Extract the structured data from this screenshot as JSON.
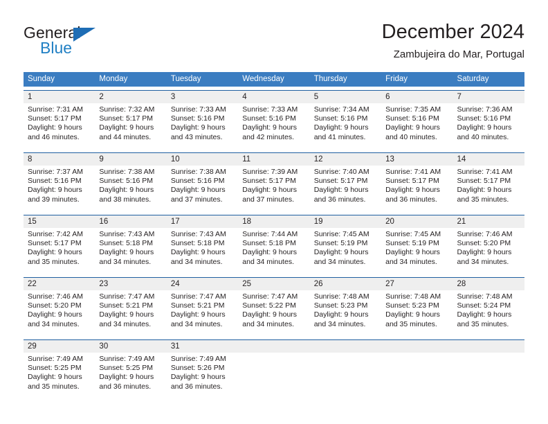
{
  "brand": {
    "word_one": "General",
    "word_two": "Blue",
    "triangle_icon": "triangle-icon",
    "accent_color": "#2180c4",
    "triangle_color": "#1e6db5"
  },
  "header": {
    "title": "December 2024",
    "subtitle": "Zambujeira do Mar, Portugal"
  },
  "theme": {
    "header_row_bg": "#3b7dc1",
    "week_rule_color": "#1f5fa0",
    "daynum_bg": "#efefef",
    "text_color": "#231f20"
  },
  "weekdays": [
    "Sunday",
    "Monday",
    "Tuesday",
    "Wednesday",
    "Thursday",
    "Friday",
    "Saturday"
  ],
  "weeks": [
    {
      "days": [
        {
          "num": "1",
          "sunrise": "Sunrise: 7:31 AM",
          "sunset": "Sunset: 5:17 PM",
          "daylight_1": "Daylight: 9 hours",
          "daylight_2": "and 46 minutes."
        },
        {
          "num": "2",
          "sunrise": "Sunrise: 7:32 AM",
          "sunset": "Sunset: 5:17 PM",
          "daylight_1": "Daylight: 9 hours",
          "daylight_2": "and 44 minutes."
        },
        {
          "num": "3",
          "sunrise": "Sunrise: 7:33 AM",
          "sunset": "Sunset: 5:16 PM",
          "daylight_1": "Daylight: 9 hours",
          "daylight_2": "and 43 minutes."
        },
        {
          "num": "4",
          "sunrise": "Sunrise: 7:33 AM",
          "sunset": "Sunset: 5:16 PM",
          "daylight_1": "Daylight: 9 hours",
          "daylight_2": "and 42 minutes."
        },
        {
          "num": "5",
          "sunrise": "Sunrise: 7:34 AM",
          "sunset": "Sunset: 5:16 PM",
          "daylight_1": "Daylight: 9 hours",
          "daylight_2": "and 41 minutes."
        },
        {
          "num": "6",
          "sunrise": "Sunrise: 7:35 AM",
          "sunset": "Sunset: 5:16 PM",
          "daylight_1": "Daylight: 9 hours",
          "daylight_2": "and 40 minutes."
        },
        {
          "num": "7",
          "sunrise": "Sunrise: 7:36 AM",
          "sunset": "Sunset: 5:16 PM",
          "daylight_1": "Daylight: 9 hours",
          "daylight_2": "and 40 minutes."
        }
      ]
    },
    {
      "days": [
        {
          "num": "8",
          "sunrise": "Sunrise: 7:37 AM",
          "sunset": "Sunset: 5:16 PM",
          "daylight_1": "Daylight: 9 hours",
          "daylight_2": "and 39 minutes."
        },
        {
          "num": "9",
          "sunrise": "Sunrise: 7:38 AM",
          "sunset": "Sunset: 5:16 PM",
          "daylight_1": "Daylight: 9 hours",
          "daylight_2": "and 38 minutes."
        },
        {
          "num": "10",
          "sunrise": "Sunrise: 7:38 AM",
          "sunset": "Sunset: 5:16 PM",
          "daylight_1": "Daylight: 9 hours",
          "daylight_2": "and 37 minutes."
        },
        {
          "num": "11",
          "sunrise": "Sunrise: 7:39 AM",
          "sunset": "Sunset: 5:17 PM",
          "daylight_1": "Daylight: 9 hours",
          "daylight_2": "and 37 minutes."
        },
        {
          "num": "12",
          "sunrise": "Sunrise: 7:40 AM",
          "sunset": "Sunset: 5:17 PM",
          "daylight_1": "Daylight: 9 hours",
          "daylight_2": "and 36 minutes."
        },
        {
          "num": "13",
          "sunrise": "Sunrise: 7:41 AM",
          "sunset": "Sunset: 5:17 PM",
          "daylight_1": "Daylight: 9 hours",
          "daylight_2": "and 36 minutes."
        },
        {
          "num": "14",
          "sunrise": "Sunrise: 7:41 AM",
          "sunset": "Sunset: 5:17 PM",
          "daylight_1": "Daylight: 9 hours",
          "daylight_2": "and 35 minutes."
        }
      ]
    },
    {
      "days": [
        {
          "num": "15",
          "sunrise": "Sunrise: 7:42 AM",
          "sunset": "Sunset: 5:17 PM",
          "daylight_1": "Daylight: 9 hours",
          "daylight_2": "and 35 minutes."
        },
        {
          "num": "16",
          "sunrise": "Sunrise: 7:43 AM",
          "sunset": "Sunset: 5:18 PM",
          "daylight_1": "Daylight: 9 hours",
          "daylight_2": "and 34 minutes."
        },
        {
          "num": "17",
          "sunrise": "Sunrise: 7:43 AM",
          "sunset": "Sunset: 5:18 PM",
          "daylight_1": "Daylight: 9 hours",
          "daylight_2": "and 34 minutes."
        },
        {
          "num": "18",
          "sunrise": "Sunrise: 7:44 AM",
          "sunset": "Sunset: 5:18 PM",
          "daylight_1": "Daylight: 9 hours",
          "daylight_2": "and 34 minutes."
        },
        {
          "num": "19",
          "sunrise": "Sunrise: 7:45 AM",
          "sunset": "Sunset: 5:19 PM",
          "daylight_1": "Daylight: 9 hours",
          "daylight_2": "and 34 minutes."
        },
        {
          "num": "20",
          "sunrise": "Sunrise: 7:45 AM",
          "sunset": "Sunset: 5:19 PM",
          "daylight_1": "Daylight: 9 hours",
          "daylight_2": "and 34 minutes."
        },
        {
          "num": "21",
          "sunrise": "Sunrise: 7:46 AM",
          "sunset": "Sunset: 5:20 PM",
          "daylight_1": "Daylight: 9 hours",
          "daylight_2": "and 34 minutes."
        }
      ]
    },
    {
      "days": [
        {
          "num": "22",
          "sunrise": "Sunrise: 7:46 AM",
          "sunset": "Sunset: 5:20 PM",
          "daylight_1": "Daylight: 9 hours",
          "daylight_2": "and 34 minutes."
        },
        {
          "num": "23",
          "sunrise": "Sunrise: 7:47 AM",
          "sunset": "Sunset: 5:21 PM",
          "daylight_1": "Daylight: 9 hours",
          "daylight_2": "and 34 minutes."
        },
        {
          "num": "24",
          "sunrise": "Sunrise: 7:47 AM",
          "sunset": "Sunset: 5:21 PM",
          "daylight_1": "Daylight: 9 hours",
          "daylight_2": "and 34 minutes."
        },
        {
          "num": "25",
          "sunrise": "Sunrise: 7:47 AM",
          "sunset": "Sunset: 5:22 PM",
          "daylight_1": "Daylight: 9 hours",
          "daylight_2": "and 34 minutes."
        },
        {
          "num": "26",
          "sunrise": "Sunrise: 7:48 AM",
          "sunset": "Sunset: 5:23 PM",
          "daylight_1": "Daylight: 9 hours",
          "daylight_2": "and 34 minutes."
        },
        {
          "num": "27",
          "sunrise": "Sunrise: 7:48 AM",
          "sunset": "Sunset: 5:23 PM",
          "daylight_1": "Daylight: 9 hours",
          "daylight_2": "and 35 minutes."
        },
        {
          "num": "28",
          "sunrise": "Sunrise: 7:48 AM",
          "sunset": "Sunset: 5:24 PM",
          "daylight_1": "Daylight: 9 hours",
          "daylight_2": "and 35 minutes."
        }
      ]
    },
    {
      "days": [
        {
          "num": "29",
          "sunrise": "Sunrise: 7:49 AM",
          "sunset": "Sunset: 5:25 PM",
          "daylight_1": "Daylight: 9 hours",
          "daylight_2": "and 35 minutes."
        },
        {
          "num": "30",
          "sunrise": "Sunrise: 7:49 AM",
          "sunset": "Sunset: 5:25 PM",
          "daylight_1": "Daylight: 9 hours",
          "daylight_2": "and 36 minutes."
        },
        {
          "num": "31",
          "sunrise": "Sunrise: 7:49 AM",
          "sunset": "Sunset: 5:26 PM",
          "daylight_1": "Daylight: 9 hours",
          "daylight_2": "and 36 minutes."
        },
        {
          "num": "",
          "sunrise": "",
          "sunset": "",
          "daylight_1": "",
          "daylight_2": ""
        },
        {
          "num": "",
          "sunrise": "",
          "sunset": "",
          "daylight_1": "",
          "daylight_2": ""
        },
        {
          "num": "",
          "sunrise": "",
          "sunset": "",
          "daylight_1": "",
          "daylight_2": ""
        },
        {
          "num": "",
          "sunrise": "",
          "sunset": "",
          "daylight_1": "",
          "daylight_2": ""
        }
      ]
    }
  ]
}
